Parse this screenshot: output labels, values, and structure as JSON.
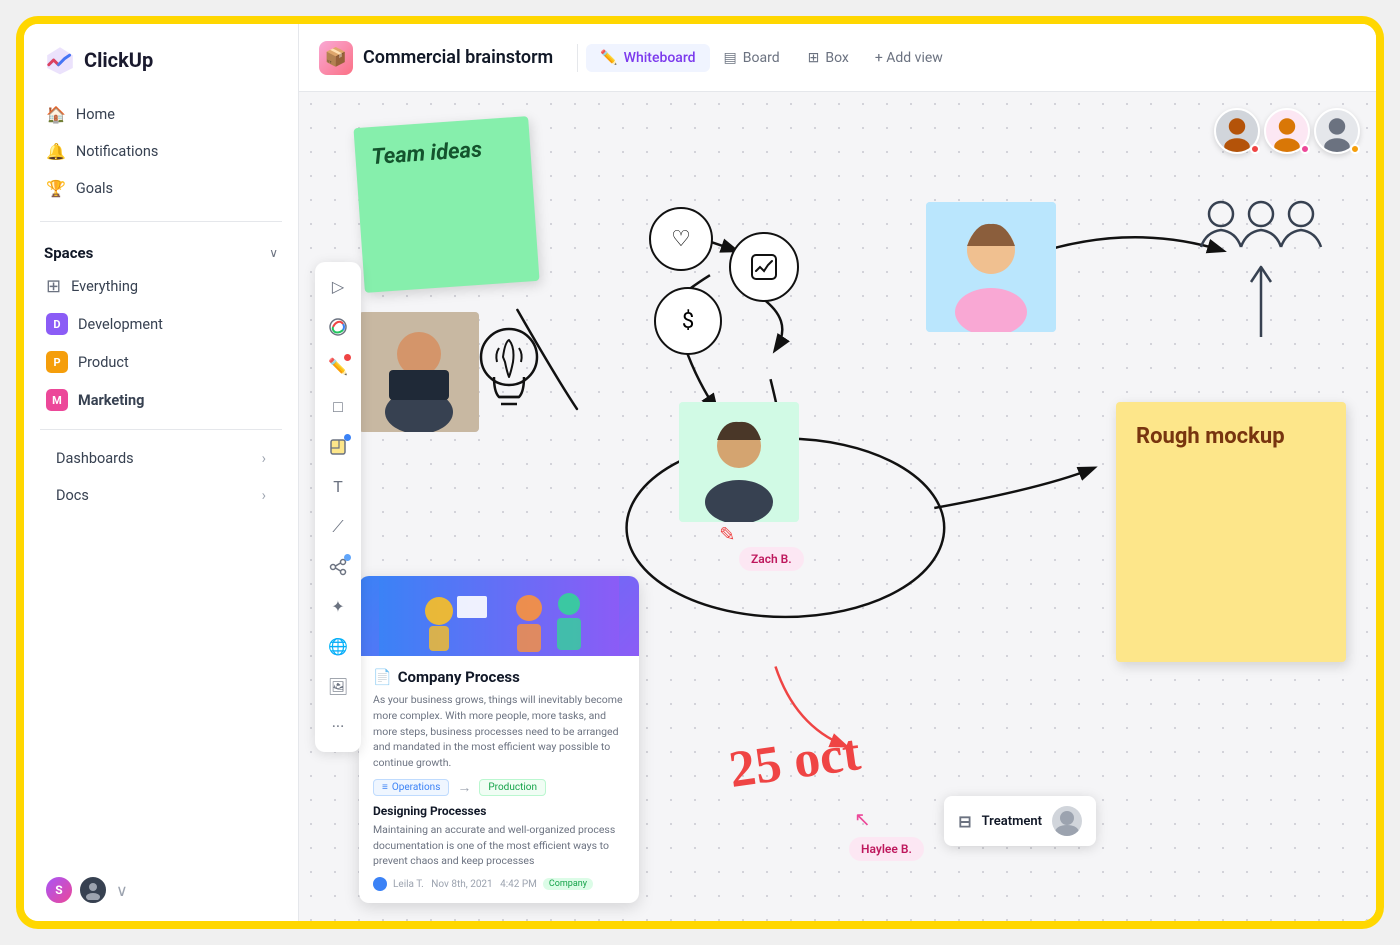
{
  "app": {
    "name": "ClickUp"
  },
  "sidebar": {
    "nav": [
      {
        "id": "home",
        "label": "Home",
        "icon": "🏠"
      },
      {
        "id": "notifications",
        "label": "Notifications",
        "icon": "🔔"
      },
      {
        "id": "goals",
        "label": "Goals",
        "icon": "🏆"
      }
    ],
    "spaces_label": "Spaces",
    "spaces": [
      {
        "id": "everything",
        "label": "Everything",
        "color": null,
        "letter": null
      },
      {
        "id": "development",
        "label": "Development",
        "color": "#8b5cf6",
        "letter": "D"
      },
      {
        "id": "product",
        "label": "Product",
        "color": "#f59e0b",
        "letter": "P"
      },
      {
        "id": "marketing",
        "label": "Marketing",
        "color": "#ec4899",
        "letter": "M",
        "bold": true
      }
    ],
    "links": [
      {
        "id": "dashboards",
        "label": "Dashboards"
      },
      {
        "id": "docs",
        "label": "Docs"
      }
    ],
    "user_initials": "S"
  },
  "header": {
    "project_title": "Commercial brainstorm",
    "views": [
      {
        "id": "whiteboard",
        "label": "Whiteboard",
        "active": true
      },
      {
        "id": "board",
        "label": "Board",
        "active": false
      },
      {
        "id": "box",
        "label": "Box",
        "active": false
      }
    ],
    "add_view_label": "+ Add view"
  },
  "whiteboard": {
    "sticky_green_text": "Team ideas",
    "sticky_yellow_text": "Rough mockup",
    "doc_card": {
      "title": "Company Process",
      "body": "As your business grows, things will inevitably become more complex. With more people, more tasks, and more steps, business processes need to be arranged and mandated in the most efficient way possible to continue growth.",
      "tags": [
        "Operations",
        "Production"
      ],
      "section": "Designing Processes",
      "section_body": "Maintaining an accurate and well-organized process documentation is one of the most efficient ways to prevent chaos and keep processes",
      "footer": "Leila T.  Nov 8th, 2021  4:42 PM",
      "badge": "Company"
    },
    "name_badges": [
      "Zach B.",
      "Haylee B."
    ],
    "treatment_task": "Treatment",
    "date_handwriting": "25 oct",
    "users": [
      {
        "color": "#ef4444"
      },
      {
        "color": "#ec4899"
      },
      {
        "color": "#f59e0b"
      }
    ]
  }
}
